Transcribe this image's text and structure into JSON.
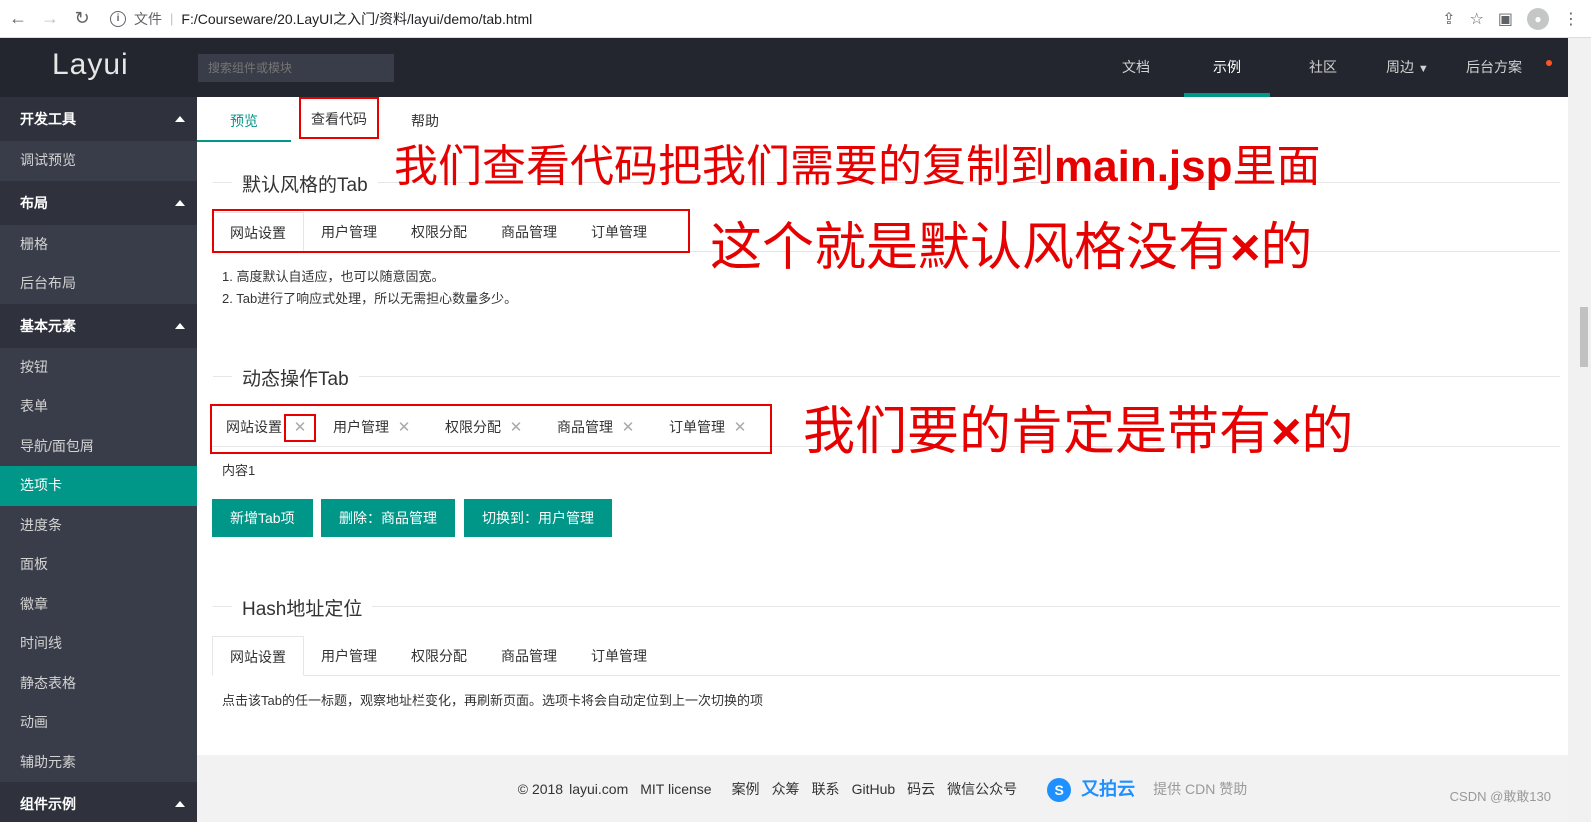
{
  "browser": {
    "file_label": "文件",
    "url": "F:/Courseware/20.LayUI之入门/资料/layui/demo/tab.html"
  },
  "topnav": {
    "logo": "Layui",
    "search_placeholder": "搜索组件或模块",
    "links": [
      "文档",
      "示例",
      "社区",
      "周边",
      "后台方案"
    ]
  },
  "sidebar": {
    "groups": [
      {
        "label": "开发工具",
        "items": [
          "调试预览"
        ]
      },
      {
        "label": "布局",
        "items": [
          "栅格",
          "后台布局"
        ]
      },
      {
        "label": "基本元素",
        "items": [
          "按钮",
          "表单",
          "导航/面包屑",
          "选项卡",
          "进度条",
          "面板",
          "徽章",
          "时间线",
          "静态表格",
          "动画",
          "辅助元素"
        ]
      },
      {
        "label": "组件示例",
        "items": []
      }
    ]
  },
  "page_tabs": [
    "预览",
    "查看代码",
    "帮助"
  ],
  "section1": {
    "title": "默认风格的Tab",
    "tabs": [
      "网站设置",
      "用户管理",
      "权限分配",
      "商品管理",
      "订单管理"
    ],
    "lines": [
      "1. 高度默认自适应，也可以随意固宽。",
      "2. Tab进行了响应式处理，所以无需担心数量多少。"
    ]
  },
  "section2": {
    "title": "动态操作Tab",
    "tabs": [
      "网站设置",
      "用户管理",
      "权限分配",
      "商品管理",
      "订单管理"
    ],
    "content": "内容1",
    "buttons": [
      "新增Tab项",
      "删除：商品管理",
      "切换到：用户管理"
    ]
  },
  "section3": {
    "title": "Hash地址定位",
    "tabs": [
      "网站设置",
      "用户管理",
      "权限分配",
      "商品管理",
      "订单管理"
    ],
    "content": "点击该Tab的任一标题，观察地址栏变化，再刷新页面。选项卡将会自动定位到上一次切换的项"
  },
  "annotations": {
    "a1_prefix": "我们查看代码把我们需要的复制到",
    "a1_bold": "main.jsp",
    "a1_suffix": "里面",
    "a2_prefix": "这个就是默认风格没有",
    "a2_x": "×",
    "a2_suffix": "的",
    "a3_prefix": "我们要的肯定是带有",
    "a3_x": "×",
    "a3_suffix": "的"
  },
  "footer": {
    "copyright": "© 2018",
    "site": "layui.com",
    "license": "MIT license",
    "links": [
      "案例",
      "众筹",
      "联系",
      "GitHub",
      "码云",
      "微信公众号"
    ],
    "upyun": "又拍云",
    "sponsor": "提供 CDN 赞助"
  },
  "watermark": "CSDN @敢敢130",
  "colors": {
    "primary": "#009688",
    "annotation_red": "#e60000",
    "nav_dark": "#23262e",
    "sidebar": "#393d49"
  }
}
